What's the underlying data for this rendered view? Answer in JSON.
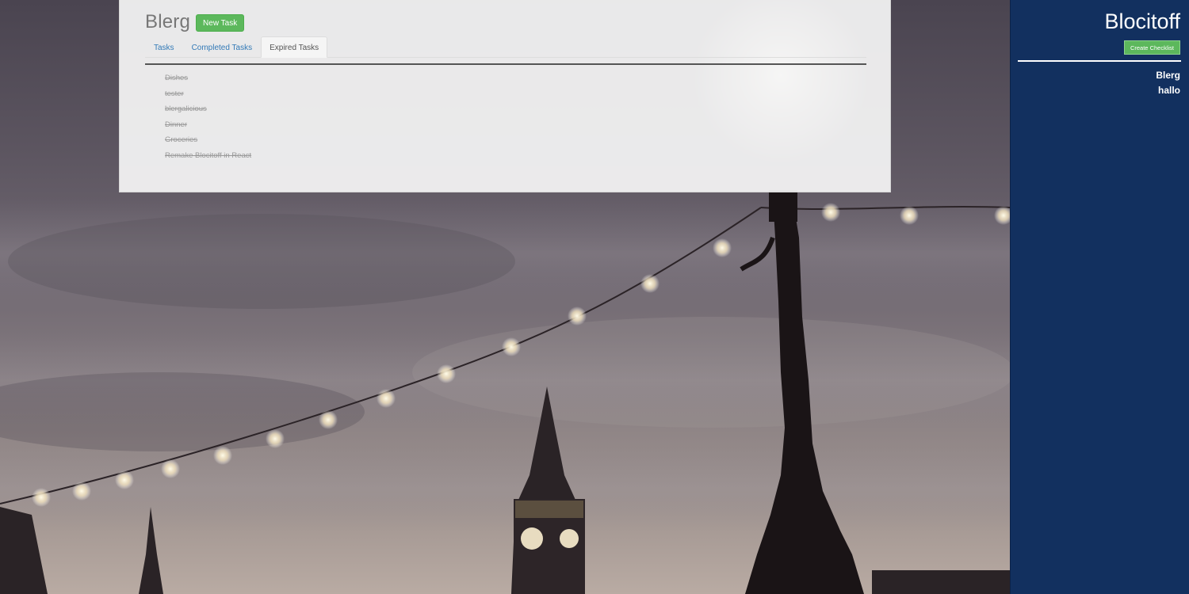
{
  "main": {
    "checklist_title": "Blerg",
    "new_task_label": "New Task",
    "tabs": [
      {
        "label": "Tasks",
        "active": false
      },
      {
        "label": "Completed Tasks",
        "active": false
      },
      {
        "label": "Expired Tasks",
        "active": true
      }
    ],
    "tasks": [
      "Dishes",
      "tester",
      "blergalicious",
      "Dinner",
      "Groceries",
      "Remake Blocitoff in React"
    ]
  },
  "sidebar": {
    "brand": "Blocitoff",
    "create_checklist_label": "Create Checklist",
    "checklists": [
      "Blerg",
      "hallo"
    ]
  },
  "colors": {
    "sidebar_bg": "#12305f",
    "button_green": "#5cb85c",
    "link_blue": "#337ab7"
  }
}
